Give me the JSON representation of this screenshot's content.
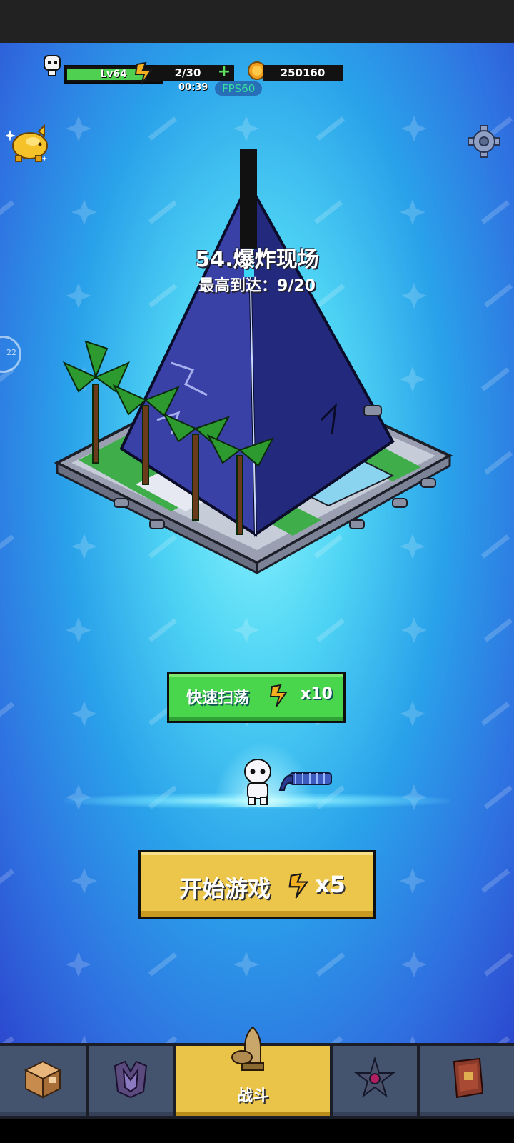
{
  "hud": {
    "level": "Lv64",
    "level_progress": 0.85,
    "energy": "2/30",
    "energy_plus": "+",
    "timer": "00:39",
    "fps": "FPS60",
    "coins": "250160"
  },
  "side": {
    "circle_text": "22"
  },
  "stage": {
    "title": "54.爆炸现场",
    "best": "最高到达：9/20"
  },
  "sweep_button": {
    "label": "快速扫荡",
    "cost": "x10"
  },
  "start_button": {
    "label": "开始游戏",
    "cost": "x5"
  },
  "nav": {
    "items": [
      {
        "icon": "box-icon",
        "label": ""
      },
      {
        "icon": "armor-icon",
        "label": ""
      },
      {
        "icon": "bullet-icon",
        "label": "战斗"
      },
      {
        "icon": "skill-star-icon",
        "label": ""
      },
      {
        "icon": "book-icon",
        "label": ""
      }
    ],
    "active_index": 2
  },
  "colors": {
    "bg_top": "#2c49cf",
    "bg_center": "#8ff6ff",
    "sweep_green": "#49d64c",
    "start_yellow": "#ecc64a",
    "nav_bg": "#44536e",
    "nav_active": "#e9c449"
  }
}
